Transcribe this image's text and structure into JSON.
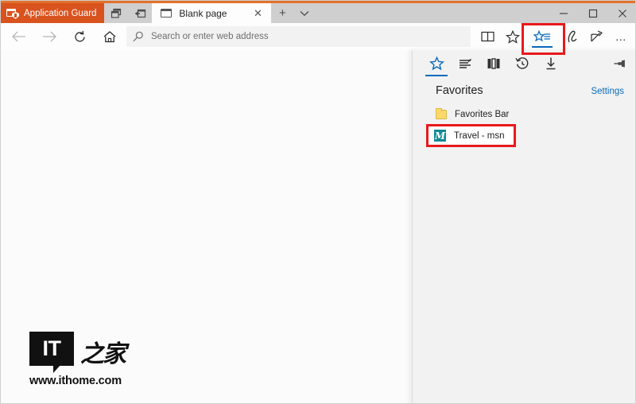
{
  "window": {
    "app_guard_tab_label": "Application Guard",
    "accent_orange": "#d9531e",
    "titlebar_icons": [
      "restore-windows-icon",
      "open-in-new-window-icon"
    ],
    "controls": {
      "minimize": "–",
      "maximize": "☐",
      "close": "✕"
    }
  },
  "tabs": {
    "active": {
      "title": "Blank page",
      "close_label": "✕",
      "icon": "blank-page-icon"
    },
    "new_tab_label": "+",
    "tab_menu_label": "⌄"
  },
  "toolbar": {
    "back_label": "←",
    "forward_label": "→",
    "refresh_label": "↻",
    "home_label": "⌂",
    "address": {
      "placeholder": "Search or enter web address",
      "value": ""
    },
    "reading_view": "reading-view-icon",
    "favorite": "favorite-star-icon",
    "hub": "hub-favorites-icon",
    "notes": "make-a-note-icon",
    "share": "share-icon",
    "more_label": "…"
  },
  "hub": {
    "tabs": [
      {
        "name": "favorites",
        "icon": "favorites-star-icon",
        "active": true
      },
      {
        "name": "reading-list",
        "icon": "reading-list-icon",
        "active": false
      },
      {
        "name": "books",
        "icon": "books-icon",
        "active": false
      },
      {
        "name": "history",
        "icon": "history-clock-icon",
        "active": false
      },
      {
        "name": "downloads",
        "icon": "downloads-arrow-icon",
        "active": false
      }
    ],
    "pin_label": "pin-icon",
    "title": "Favorites",
    "settings_label": "Settings",
    "items": [
      {
        "label": "Favorites Bar",
        "icon": "folder-icon",
        "type": "folder"
      },
      {
        "label": "Travel - msn",
        "icon": "msn-favicon",
        "type": "bookmark",
        "favicon_letter": "̼"
      }
    ]
  },
  "watermark": {
    "logo_text": "IT",
    "logo_cn": "之家",
    "url": "www.ithome.com"
  },
  "annotations": {
    "highlight_color": "#e8191c",
    "boxes": [
      "hub-button-highlight",
      "travel-msn-highlight"
    ]
  }
}
